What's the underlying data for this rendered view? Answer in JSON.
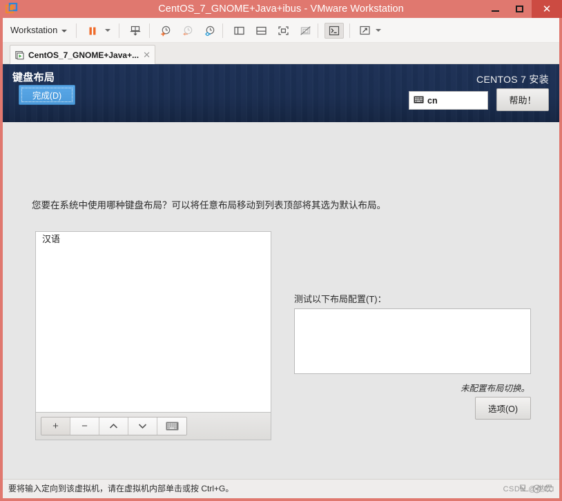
{
  "window": {
    "title": "CentOS_7_GNOME+Java+ibus - VMware Workstation",
    "logo_icon": "vmware-logo-icon",
    "minimize_label": "minimize",
    "maximize_label": "maximize",
    "close_label": "close",
    "accent_color": "#e0786f",
    "close_button_color": "#cc4b42"
  },
  "toolbar": {
    "menu_label": "Workstation",
    "items": [
      {
        "icon": "pause-icon",
        "name": "suspend-button"
      },
      {
        "icon": "chevron-down-icon",
        "name": "suspend-dropdown"
      },
      {
        "icon": "snapshot-save-icon",
        "name": "snapshot-button"
      },
      {
        "icon": "snapshot-manager-icon",
        "name": "snapshot-take-button"
      },
      {
        "icon": "snapshot-revert-icon",
        "name": "snapshot-revert-button"
      },
      {
        "icon": "snapshot-settings-icon",
        "name": "snapshot-manage-button"
      },
      {
        "icon": "show-library-icon",
        "name": "show-library-button"
      },
      {
        "icon": "show-thumbnail-bar-icon",
        "name": "show-thumbnail-bar-button"
      },
      {
        "icon": "fullscreen-icon",
        "name": "enter-fullscreen-button"
      },
      {
        "icon": "unity-mode-icon",
        "name": "unity-mode-button"
      },
      {
        "icon": "console-icon",
        "name": "console-view-button"
      },
      {
        "icon": "stretch-icon",
        "name": "stretch-guest-button"
      },
      {
        "icon": "chevron-down-icon",
        "name": "stretch-dropdown"
      }
    ]
  },
  "tab": {
    "label": "CentOS_7_GNOME+Java+...",
    "icon": "vm-running-icon",
    "close_icon": "close-icon"
  },
  "installer": {
    "page_title": "键盘布局",
    "done_button": "完成(D)",
    "brand": "CENTOS 7 安装",
    "layout_indicator": {
      "icon": "keyboard-icon",
      "value": "cn"
    },
    "help_button": "帮助！",
    "prompt": "您要在系统中使用哪种键盘布局？可以将任意布局移动到列表顶部将其选为默认布局。",
    "layout_list": {
      "items": [
        "汉语"
      ],
      "toolbar": [
        {
          "glyph": "+",
          "name": "add-layout-button"
        },
        {
          "glyph": "−",
          "name": "remove-layout-button"
        },
        {
          "glyph": "∧",
          "name": "move-layout-up-button"
        },
        {
          "glyph": "∨",
          "name": "move-layout-down-button"
        },
        {
          "glyph": "keyboard",
          "name": "preview-layout-button"
        }
      ]
    },
    "test_label": "测试以下布局配置(T)：",
    "test_input_value": "",
    "test_input_placeholder": "",
    "switch_note": "未配置布局切换。",
    "options_button": "选项(O)",
    "header_gradient_top": "#1d3156",
    "header_gradient_bottom": "#152542",
    "done_button_color": "#4c9ada"
  },
  "statusbar": {
    "message": "要将输入定向到该虚拟机，请在虚拟机内部单击或按 Ctrl+G。",
    "watermark": "CSDN @燃吹"
  }
}
